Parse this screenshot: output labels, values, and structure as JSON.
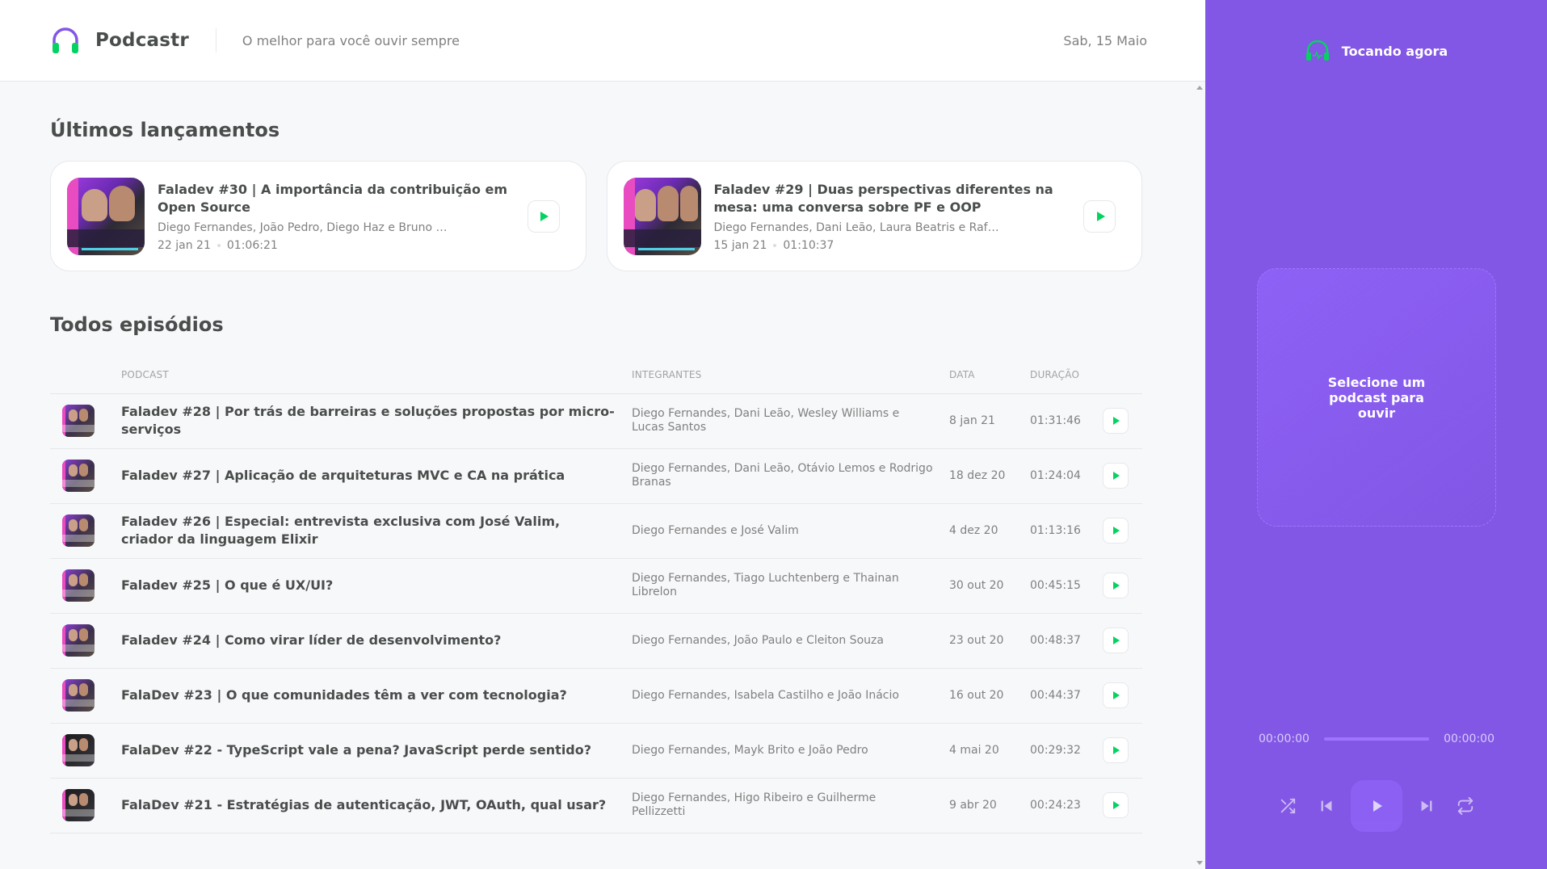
{
  "header": {
    "app_name": "Podcastr",
    "tagline": "O melhor para você ouvir sempre",
    "date": "Sab, 15 Maio"
  },
  "latest": {
    "title": "Últimos lançamentos",
    "episodes": [
      {
        "title": "Faladev #30 | A importância da contribuição em Open Source",
        "members": "Diego Fernandes, João Pedro, Diego Haz e Bruno Le...",
        "date": "22 jan 21",
        "duration": "01:06:21"
      },
      {
        "title": "Faladev #29 | Duas perspectivas diferentes na mesa: uma conversa sobre PF e OOP",
        "members": "Diego Fernandes, Dani Leão, Laura Beatris e Rafael ...",
        "date": "15 jan 21",
        "duration": "01:10:37"
      }
    ]
  },
  "all": {
    "title": "Todos episódios",
    "columns": [
      "Podcast",
      "Integrantes",
      "Data",
      "Duração"
    ],
    "episodes": [
      {
        "title": "Faladev #28 | Por trás de barreiras e soluções propostas por micro-serviços",
        "members": "Diego Fernandes, Dani Leão, Wesley Williams e Lucas Santos",
        "date": "8 jan 21",
        "duration": "01:31:46"
      },
      {
        "title": "Faladev #27 | Aplicação de arquiteturas MVC e CA na prática",
        "members": "Diego Fernandes, Dani Leão, Otávio Lemos e Rodrigo Branas",
        "date": "18 dez 20",
        "duration": "01:24:04"
      },
      {
        "title": "Faladev #26 | Especial: entrevista exclusiva com José Valim, criador da linguagem Elixir",
        "members": "Diego Fernandes e José Valim",
        "date": "4 dez 20",
        "duration": "01:13:16"
      },
      {
        "title": "Faladev #25 | O que é UX/UI?",
        "members": "Diego Fernandes, Tiago Luchtenberg e Thainan Librelon",
        "date": "30 out 20",
        "duration": "00:45:15"
      },
      {
        "title": "Faladev #24 | Como virar líder de desenvolvimento?",
        "members": "Diego Fernandes, João Paulo e Cleiton Souza",
        "date": "23 out 20",
        "duration": "00:48:37"
      },
      {
        "title": "FalaDev #23 | O que comunidades têm a ver com tecnologia?",
        "members": "Diego Fernandes, Isabela Castilho e João Inácio",
        "date": "16 out 20",
        "duration": "00:44:37"
      },
      {
        "title": "FalaDev #22 - TypeScript vale a pena? JavaScript perde sentido?",
        "members": "Diego Fernandes, Mayk Brito e João Pedro",
        "date": "4 mai 20",
        "duration": "00:29:32"
      },
      {
        "title": "FalaDev #21 - Estratégias de autenticação, JWT, OAuth, qual usar?",
        "members": "Diego Fernandes, Higo Ribeiro e Guilherme Pellizzetti",
        "date": "9 abr 20",
        "duration": "00:24:23"
      }
    ]
  },
  "player": {
    "header": "Tocando agora",
    "empty_message": "Selecione um podcast para ouvir",
    "current_time": "00:00:00",
    "total_time": "00:00:00",
    "progress_fraction": 0
  },
  "colors": {
    "accent_purple": "#8257e5",
    "play_green": "#04d361",
    "text_dark": "#494d4b",
    "text_muted": "#808080"
  }
}
